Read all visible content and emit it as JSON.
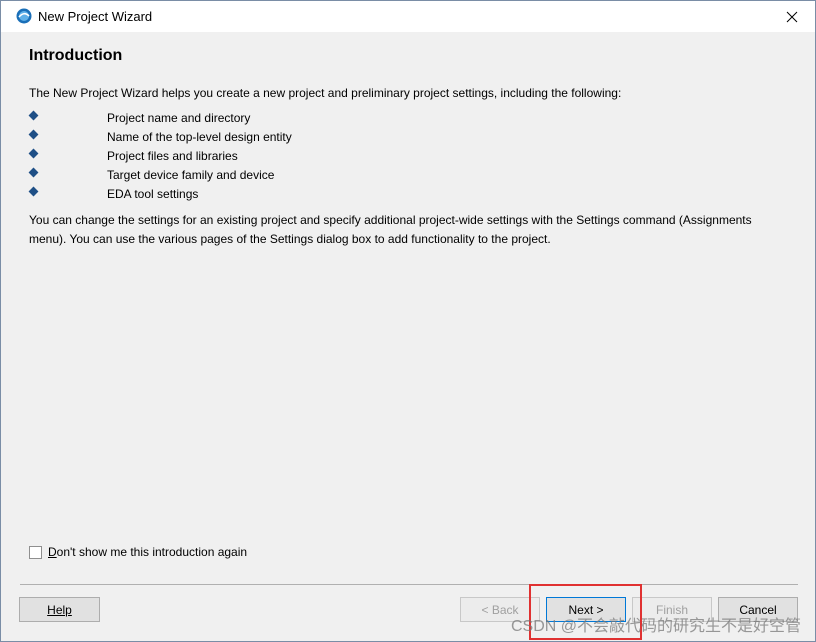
{
  "window": {
    "title": "New Project Wizard"
  },
  "page": {
    "heading": "Introduction",
    "intro": "The New Project Wizard helps you create a new project and preliminary project settings, including the following:",
    "features": [
      "Project name and directory",
      "Name of the top-level design entity",
      "Project files and libraries",
      "Target device family and device",
      "EDA tool settings"
    ],
    "description": "You can change the settings for an existing project and specify additional project-wide settings with the Settings command (Assignments menu). You can use the various pages of the Settings dialog box to add functionality to the project."
  },
  "checkbox": {
    "label_prefix": "D",
    "label_rest": "on't show me this introduction again",
    "checked": false
  },
  "buttons": {
    "help": "Help",
    "back": "< Back",
    "next": "Next >",
    "finish": "Finish",
    "cancel": "Cancel"
  },
  "watermark": "CSDN @不会敲代码的研究生不是好空管",
  "colors": {
    "accent": "#0078d7",
    "highlight": "#e03131",
    "bullet": "#1e4f86"
  },
  "icons": {
    "app": "quartus-app-icon",
    "close": "close-icon"
  }
}
